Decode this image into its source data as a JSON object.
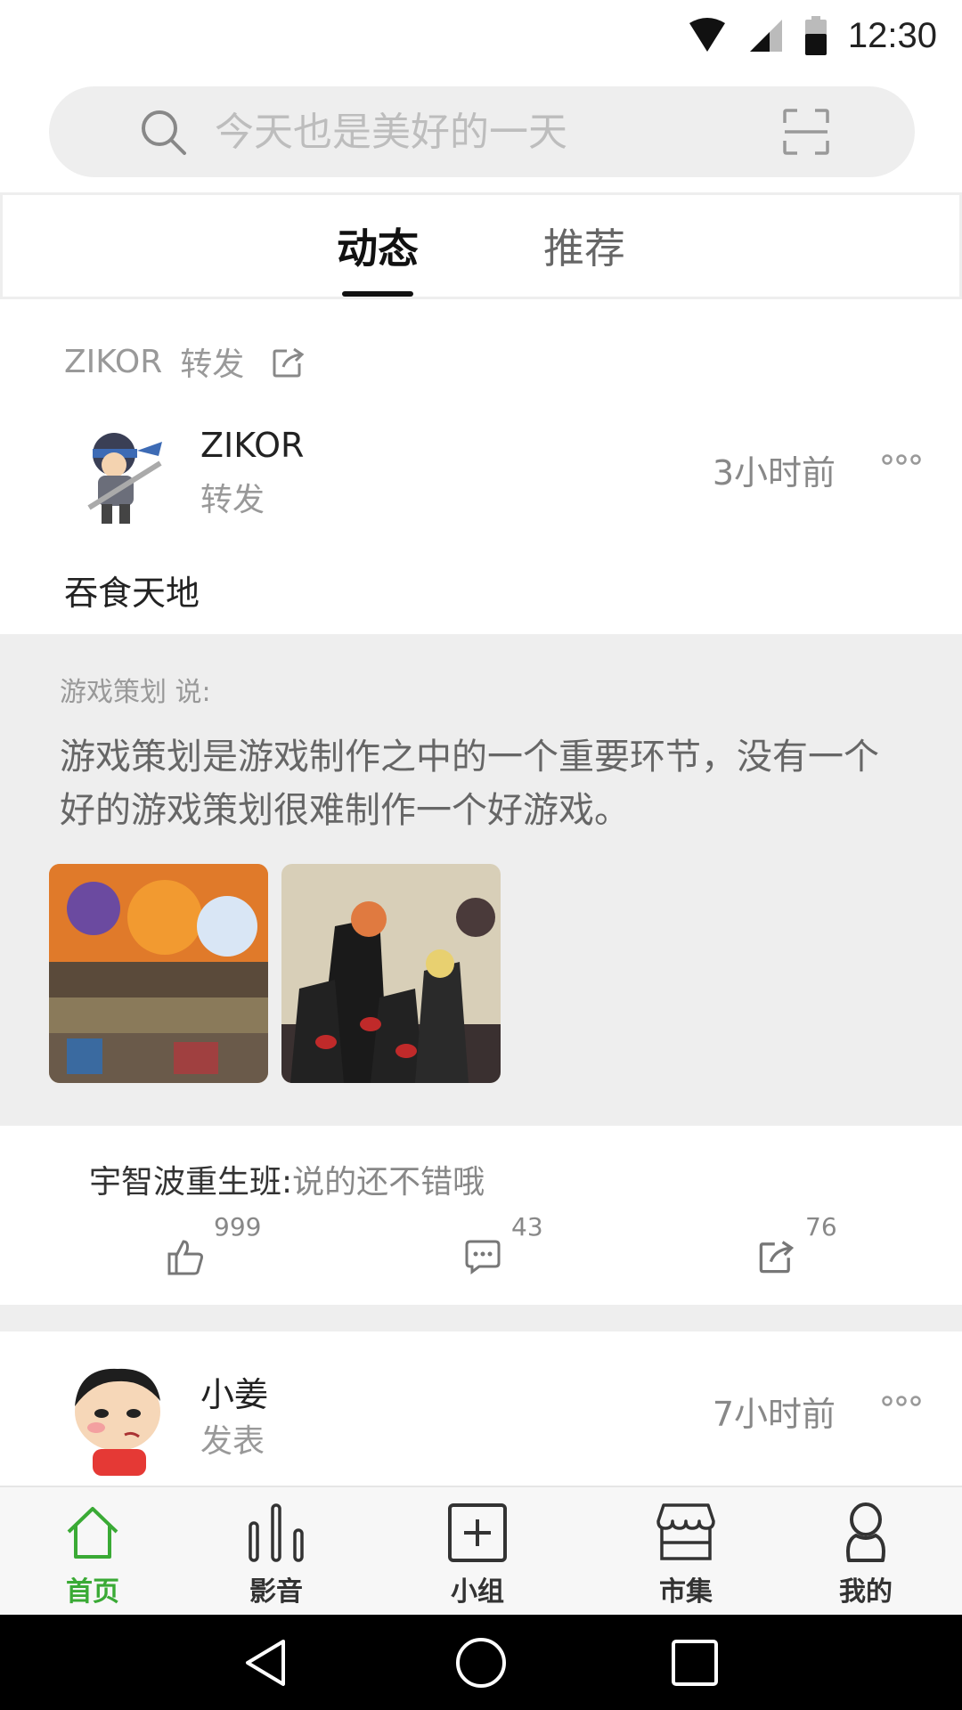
{
  "status_bar": {
    "time": "12:30",
    "icons": [
      "wifi-icon",
      "signal-icon",
      "battery-icon"
    ]
  },
  "search": {
    "placeholder": "今天也是美好的一天",
    "icons": [
      "search-icon",
      "scan-icon"
    ]
  },
  "tabs": [
    {
      "label": "动态",
      "active": true
    },
    {
      "label": "推荐",
      "active": false
    }
  ],
  "feed": {
    "repost_header": {
      "user": "ZIKOR",
      "action": "转发"
    },
    "post1": {
      "user": "ZIKOR",
      "action": "转发",
      "time": "3小时前",
      "text": "吞食天地",
      "quote": {
        "author": "游戏策划 说:",
        "text": "游戏策划是游戏制作之中的一个重要环节，没有一个好的游戏策划很难制作一个好游戏。"
      },
      "comment": {
        "user": "宇智波重生班:",
        "text": "说的还不错哦"
      },
      "stats": {
        "likes": "999",
        "comments": "43",
        "shares": "76"
      }
    },
    "post2": {
      "user": "小姜",
      "action": "发表",
      "time": "7小时前"
    }
  },
  "bottom_nav": [
    {
      "label": "首页",
      "icon": "home-icon",
      "active": true
    },
    {
      "label": "影音",
      "icon": "media-icon",
      "active": false
    },
    {
      "label": "小组",
      "icon": "group-add-icon",
      "active": false
    },
    {
      "label": "市集",
      "icon": "market-icon",
      "active": false
    },
    {
      "label": "我的",
      "icon": "profile-icon",
      "active": false
    }
  ],
  "colors": {
    "accent": "#3aaa35",
    "background": "#ffffff",
    "panel": "#eeeeee",
    "muted_text": "#999999"
  }
}
